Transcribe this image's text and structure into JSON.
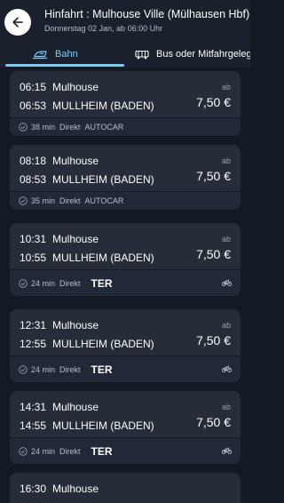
{
  "header": {
    "title": "Hinfahrt : Mulhouse Ville (Mülhausen Hbf)",
    "subtitle": "Donnerstag 02 Jan, ab 06:00 Uhr"
  },
  "tabs": [
    {
      "label": "Bahn",
      "icon": "train-icon",
      "active": true
    },
    {
      "label": "Bus oder Mitfahrgelegenheit",
      "icon": "bus-icon",
      "active": false
    }
  ],
  "colors": {
    "accent": "#7ccbf2",
    "background": "#141a24",
    "card": "#262d39"
  },
  "connections": [
    {
      "dep_time": "06:15",
      "dep_station": "Mulhouse",
      "arr_time": "06:53",
      "arr_station": "MULLHEIM (BADEN)",
      "price_prefix": "ab",
      "price": "7,50 €",
      "duration": "38 min",
      "type": "Direkt",
      "operator": "AUTOCAR",
      "bike": false
    },
    {
      "dep_time": "08:18",
      "dep_station": "Mulhouse",
      "arr_time": "08:53",
      "arr_station": "MULLHEIM (BADEN)",
      "price_prefix": "ab",
      "price": "7,50 €",
      "duration": "35 min",
      "type": "Direkt",
      "operator": "AUTOCAR",
      "bike": false
    },
    {
      "dep_time": "10:31",
      "dep_station": "Mulhouse",
      "arr_time": "10:55",
      "arr_station": "MULLHEIM (BADEN)",
      "price_prefix": "ab",
      "price": "7,50 €",
      "duration": "24 min",
      "type": "Direkt",
      "operator": "TER",
      "bike": true
    },
    {
      "dep_time": "12:31",
      "dep_station": "Mulhouse",
      "arr_time": "12:55",
      "arr_station": "MULLHEIM (BADEN)",
      "price_prefix": "ab",
      "price": "7,50 €",
      "duration": "24 min",
      "type": "Direkt",
      "operator": "TER",
      "bike": true
    },
    {
      "dep_time": "14:31",
      "dep_station": "Mulhouse",
      "arr_time": "14:55",
      "arr_station": "MULLHEIM (BADEN)",
      "price_prefix": "ab",
      "price": "7,50 €",
      "duration": "24 min",
      "type": "Direkt",
      "operator": "TER",
      "bike": true
    },
    {
      "dep_time": "16:30",
      "dep_station": "Mulhouse",
      "arr_time": "",
      "arr_station": "",
      "price_prefix": "",
      "price": "",
      "duration": "",
      "type": "",
      "operator": "",
      "bike": false
    }
  ]
}
